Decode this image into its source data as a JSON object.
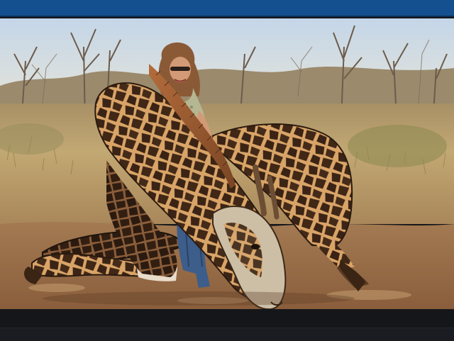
{
  "window": {
    "accent_color": "#14508f",
    "background_color": "#15161a"
  },
  "photo": {
    "subject": "photo-of-woman-kneeling-behind-dead-giraffe-in-savanna",
    "sky_color": "#cbd8e4",
    "grass_color": "#b49a63",
    "ground_color": "#9a6a44"
  }
}
